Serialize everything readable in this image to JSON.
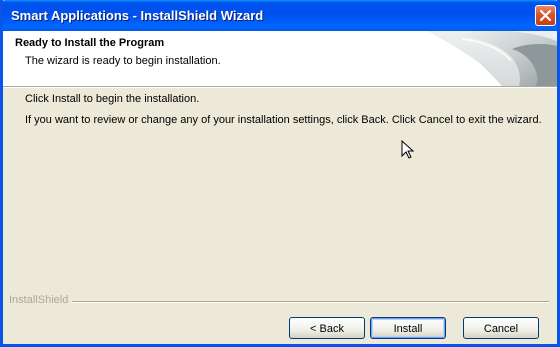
{
  "window": {
    "title": "Smart Applications - InstallShield Wizard"
  },
  "header": {
    "title": "Ready to Install the Program",
    "subtitle": "The wizard is ready to begin installation."
  },
  "body": {
    "line1": "Click Install to begin the installation.",
    "line2": "If you want to review or change any of your installation settings, click Back. Click Cancel to exit the wizard."
  },
  "footer": {
    "brand": "InstallShield"
  },
  "buttons": {
    "back": "< Back",
    "install": "Install",
    "cancel": "Cancel"
  },
  "colors": {
    "titlebar": "#0053ee",
    "close": "#d9532a",
    "dialog_bg": "#ece9d8"
  },
  "icons": {
    "close": "close-icon",
    "cursor": "mouse-cursor-icon",
    "art": "installshield-art-icon"
  }
}
